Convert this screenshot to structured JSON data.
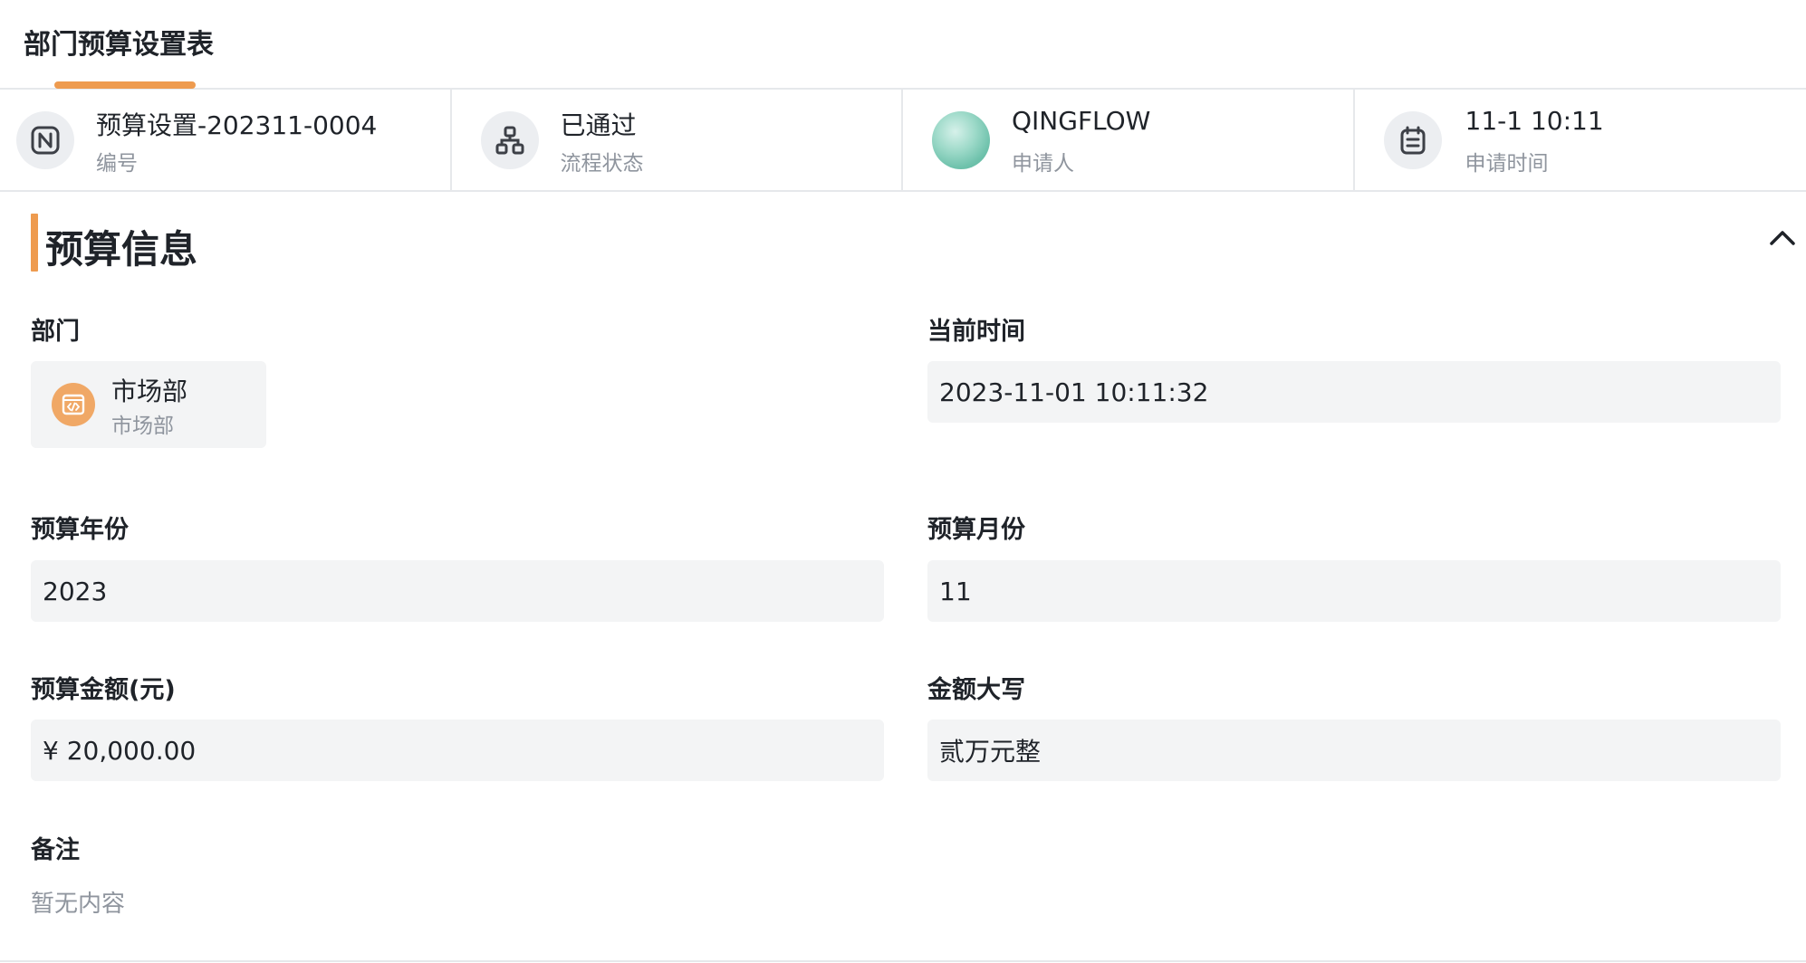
{
  "tab": {
    "title": "部门预算设置表",
    "accent_color": "#ee9b4f"
  },
  "info": {
    "number": {
      "value": "预算设置-202311-0004",
      "label": "编号",
      "icon": "letter-n-icon"
    },
    "status": {
      "value": "已通过",
      "label": "流程状态",
      "icon": "flow-chart-icon"
    },
    "applicant": {
      "value": "QINGFLOW",
      "label": "申请人",
      "icon": "avatar"
    },
    "time": {
      "value": "11-1 10:11",
      "label": "申请时间",
      "icon": "calendar-icon"
    }
  },
  "section": {
    "title": "预算信息",
    "collapse_icon": "chevron-up-icon"
  },
  "fields": {
    "department": {
      "label": "部门",
      "name": "市场部",
      "sub": "市场部",
      "icon": "department-code-icon",
      "icon_color": "#f0a866"
    },
    "current_time": {
      "label": "当前时间",
      "value": "2023-11-01 10:11:32"
    },
    "budget_year": {
      "label": "预算年份",
      "value": "2023"
    },
    "budget_month": {
      "label": "预算月份",
      "value": "11"
    },
    "budget_amount": {
      "label": "预算金额(元)",
      "value": "¥ 20,000.00"
    },
    "amount_uppercase": {
      "label": "金额大写",
      "value": "贰万元整"
    },
    "remark": {
      "label": "备注",
      "value": "暂无内容"
    }
  }
}
